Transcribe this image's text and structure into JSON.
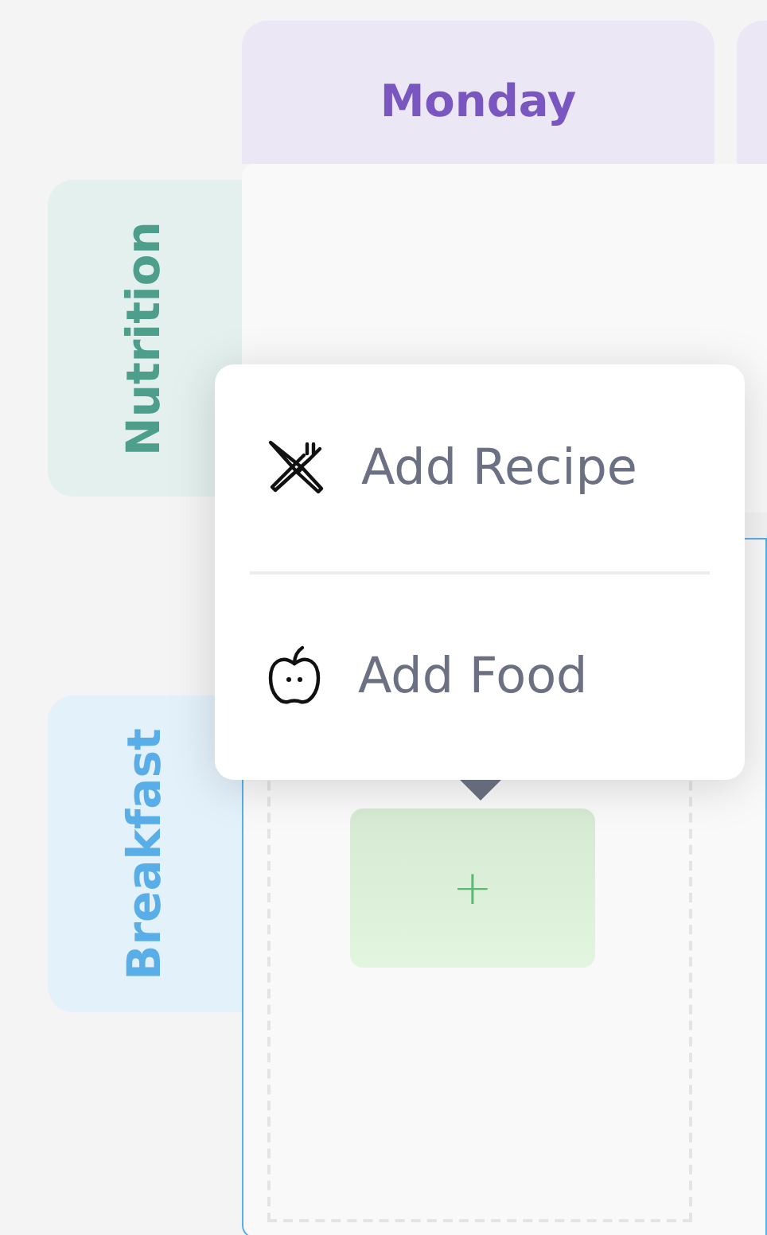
{
  "days": [
    {
      "label": "Monday"
    }
  ],
  "rows": [
    {
      "label": "Nutrition",
      "kind": "summary",
      "color": "#4e9e8c",
      "selected": false
    },
    {
      "label": "Breakfast",
      "kind": "meal",
      "color": "#5aaee8",
      "selected": true,
      "add_button": "+"
    }
  ],
  "popup_menu": {
    "items": [
      {
        "label": "Add Recipe",
        "kind": "recipe"
      },
      {
        "label": "Add Food",
        "kind": "food"
      }
    ]
  }
}
